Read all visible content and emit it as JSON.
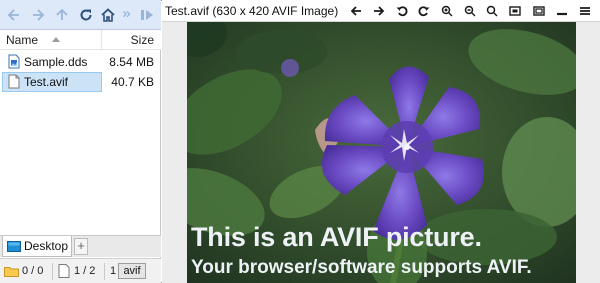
{
  "colors": {
    "nav_bar_bg": "#dde9f8",
    "selection": "#cce3f7",
    "flower_purple": "#6b4bc4"
  },
  "left_pane": {
    "nav_icons": [
      "back-icon",
      "forward-icon",
      "up-icon",
      "refresh-icon",
      "home-icon",
      "more-icon",
      "play-icon"
    ],
    "columns": {
      "name": "Name",
      "size": "Size"
    },
    "files": [
      {
        "name": "Sample.dds",
        "size": "8.54 MB",
        "icon": "document-icon",
        "selected": false
      },
      {
        "name": "Test.avif",
        "size": "40.7 KB",
        "icon": "image-file-icon",
        "selected": true
      }
    ],
    "tab": {
      "label": "Desktop",
      "icon": "desktop-icon",
      "add_label": "+"
    },
    "status": {
      "folders": "0 / 0",
      "files": "1 / 2",
      "selected_count": "1",
      "ext": "avif"
    }
  },
  "viewer": {
    "title": "Test.avif (630 x 420 AVIF Image)",
    "toolbar_icons": [
      "prev-icon",
      "next-icon",
      "rotate-left-icon",
      "rotate-right-icon",
      "zoom-in-icon",
      "zoom-out-icon",
      "zoom-reset-icon",
      "fit-icon",
      "actual-size-icon",
      "minimize-icon",
      "menu-icon"
    ],
    "caption_line1": "This is an AVIF picture.",
    "caption_line2": "Your browser/software supports AVIF."
  }
}
